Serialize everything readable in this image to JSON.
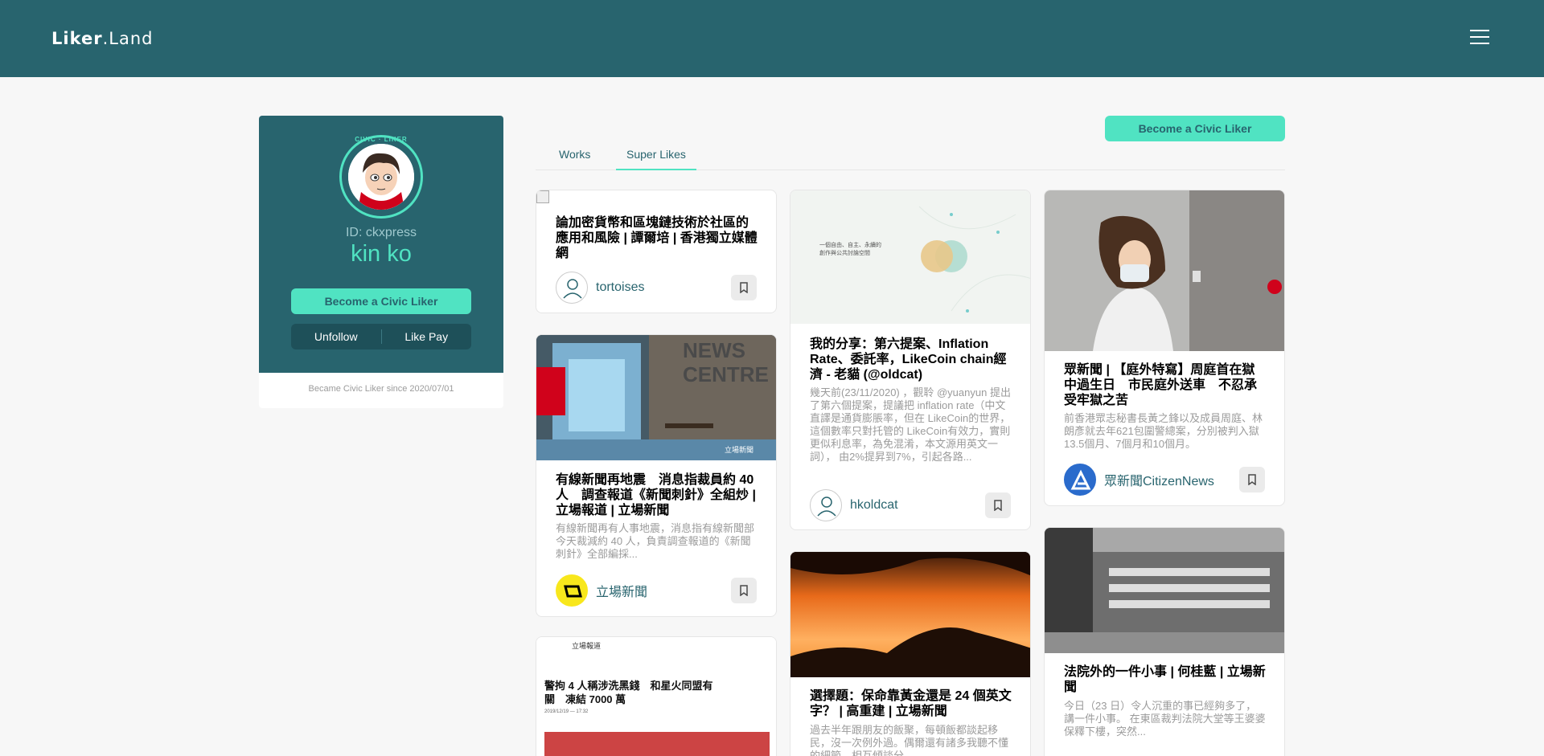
{
  "header": {
    "logo_part1": "Liker",
    "logo_part2": ".Land",
    "menu_icon": "hamburger-icon"
  },
  "profile": {
    "badge_text": "CIVIC · LIKER",
    "id_text": "ID: ckxpress",
    "name": "kin ko",
    "become_civic_label": "Become a Civic Liker",
    "unfollow_label": "Unfollow",
    "likepay_label": "Like Pay",
    "since_text": "Became Civic Liker since 2020/07/01"
  },
  "main": {
    "become_civic_label": "Become a Civic Liker",
    "tabs": [
      {
        "label": "Works"
      },
      {
        "label": "Super Likes"
      }
    ]
  },
  "cards": [
    {
      "title": "論加密貨幣和區塊鏈技術於社區的應用和風險 | 譚爾培 | 香港獨立媒體網",
      "author": "tortoises"
    },
    {
      "title": "有線新聞再地震　消息指裁員約 40 人　調查報道《新聞刺針》全組炒 | 立場報道 | 立場新聞",
      "desc": "有線新聞再有人事地震，消息指有線新聞部今天裁減約 40 人，負責調查報道的《新聞刺針》全部編採...",
      "author": "立場新聞",
      "img_text_1": "NEWS",
      "img_text_2": "CENTRE",
      "img_tag": "立場新聞"
    },
    {
      "title": "警拘 4 人稱涉洗黑錢　和星火同盟有關　凍結 7000 萬",
      "img_header": "立場報道",
      "img_date": "2019/12/19 — 17:32"
    },
    {
      "img_text": "一個自由、自主、永續的\n創作與公共討論空間",
      "title": "我的分享：第六提案、Inflation Rate、委託率，LikeCoin chain經濟 - 老貓 (@oldcat)",
      "desc": "幾天前(23/11/2020) ，觀聆 @yuanyun 提出了第六個提案，提議把 inflation rate（中文直譯是通貨膨脹率，但在 LikeCoin的世界，這個數率只對托管的 LikeCoin有效力，實則更似利息率，為免混淆，本文源用英文一詞）， 由2%提昇到7%，引起各路...",
      "author": "hkoldcat"
    },
    {
      "title": "選擇題：保命靠黃金還是 24 個英文字？ | 高重建 | 立場新聞",
      "desc": "過去半年跟朋友的飯聚，每頓飯都談起移民，沒一次例外過。偶爾還有諸多我聽不懂的細節，相互傾談分..."
    },
    {
      "title": "眾新聞 | 【庭外特寫】周庭首在獄中過生日　市民庭外送車　不忍承受牢獄之苦",
      "desc": "前香港眾志秘書長黃之鋒以及成員周庭、林朗彥就去年621包圍警總案，分別被判入獄13.5個月、7個月和10個月。",
      "author": "眾新聞CitizenNews"
    },
    {
      "title": "法院外的一件小事 | 何桂藍 | 立場新聞",
      "desc": "今日（23 日）令人沉重的事已經夠多了，講一件小事。 在東區裁判法院大堂等王婆婆保釋下樓，突然..."
    }
  ],
  "colors": {
    "brand": "#28646e",
    "accent": "#50e3c2"
  },
  "icons": {
    "bookmark": "bookmark-icon",
    "avatar": "avatar"
  }
}
